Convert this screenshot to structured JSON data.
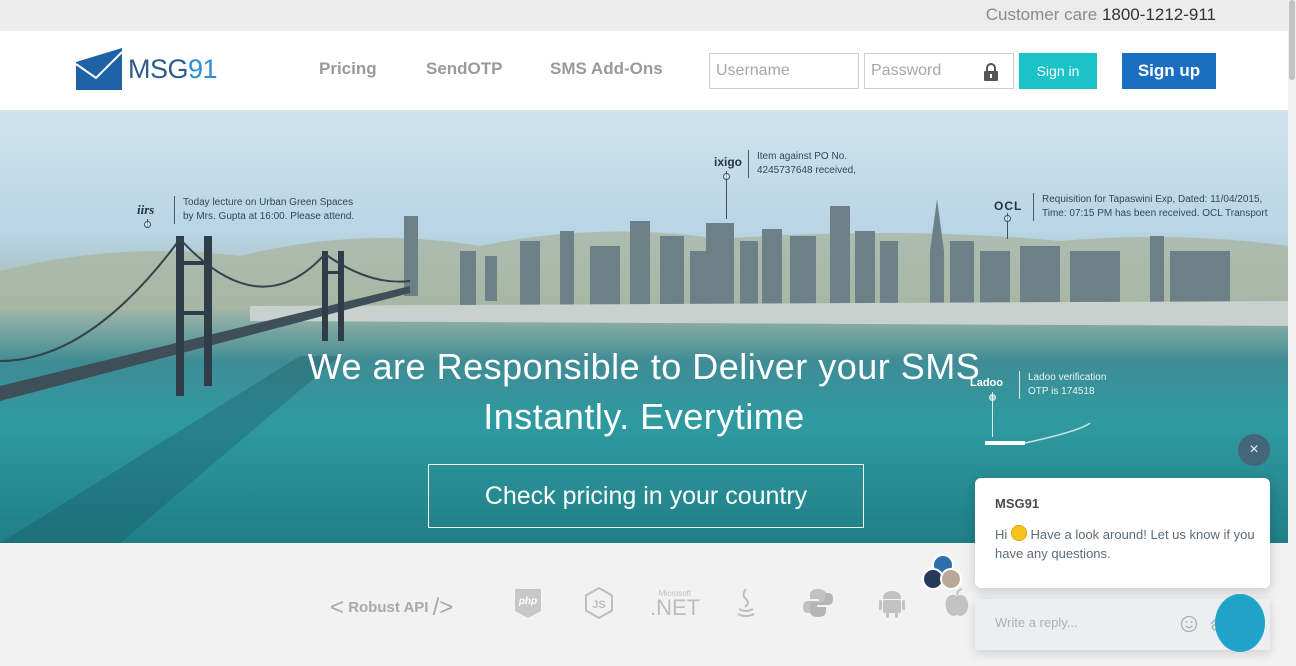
{
  "topbar": {
    "care_label": "Customer care",
    "care_number": "1800-1212-911"
  },
  "header": {
    "logo_prefix": "MSG",
    "logo_suffix": "91",
    "nav": [
      "Pricing",
      "SendOTP",
      "SMS Add-Ons"
    ],
    "username_placeholder": "Username",
    "password_placeholder": "Password",
    "signin_label": "Sign in",
    "signup_label": "Sign up"
  },
  "hero": {
    "headline_line1": "We are Responsible to Deliver your SMS",
    "headline_line2": "Instantly. Everytime",
    "cta_label": "Check pricing in your country",
    "annotations": [
      {
        "brand": "iirs",
        "line1": "Today lecture on Urban Green Spaces",
        "line2": "by Mrs. Gupta at 16:00. Please attend."
      },
      {
        "brand": "ixigo",
        "line1": "Item against PO No.",
        "line2": "4245737648 received,"
      },
      {
        "brand": "OCL",
        "line1": "Requisition for Tapaswini Exp, Dated: 11/04/2015,",
        "line2": "Time: 07:15 PM has been received. OCL Transport"
      },
      {
        "brand": "Ladoo",
        "line1": "Ladoo verification",
        "line2": "OTP is 174518"
      }
    ]
  },
  "techbar": {
    "robust_label": "Robust API",
    "net_top": "Microsoft",
    "net_main": ".NET",
    "icons": [
      "php-icon",
      "nodejs-icon",
      "dotnet-icon",
      "java-icon",
      "python-icon",
      "android-icon",
      "apple-icon"
    ]
  },
  "chat": {
    "close_symbol": "×",
    "from": "MSG91",
    "msg_pre": "Hi",
    "msg_post": "Have a look around! Let us know if you have any questions.",
    "reply_placeholder": "Write a reply..."
  },
  "colors": {
    "brand_blue": "#1b6fc2",
    "signin_teal": "#1ac3c7",
    "launcher": "#1fa3c9"
  }
}
